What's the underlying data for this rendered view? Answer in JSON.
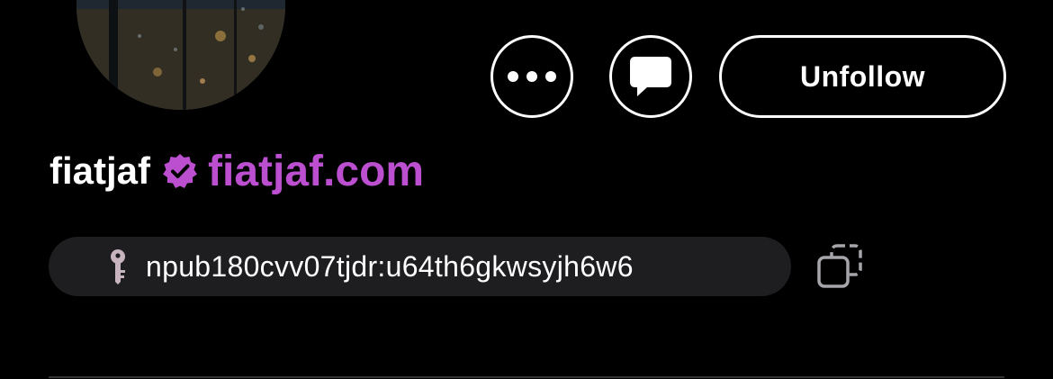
{
  "profile": {
    "display_name": "fiatjaf",
    "nip05": "fiatjaf.com",
    "npub": "npub180cvv07tjdr:u64th6gkwsyjh6w6"
  },
  "actions": {
    "more_icon": "more-dots-icon",
    "message_icon": "message-bubble-icon",
    "unfollow_label": "Unfollow",
    "copy_icon": "copy-icon"
  },
  "colors": {
    "background": "#000000",
    "accent": "#bb4fd0",
    "pill": "#1e1e21",
    "key_icon": "#c7b4be"
  }
}
